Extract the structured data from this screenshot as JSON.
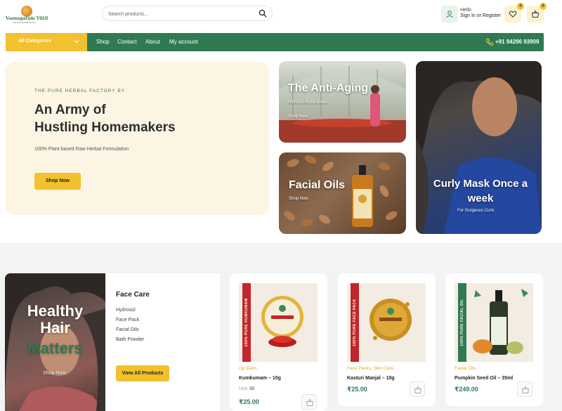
{
  "header": {
    "logo_text": "Vaanagaram Viitil",
    "logo_tagline": "The Pure Herbal Factory",
    "search_placeholder": "Search products...",
    "hello": "Hello",
    "signin": "Sign In or Register",
    "wishlist_count": "0",
    "cart_count": "0"
  },
  "nav": {
    "categories": "All Categories",
    "links": [
      "Shop",
      "Contact",
      "About",
      "My account"
    ],
    "phone": "+91 94296 93909"
  },
  "hero": {
    "eyebrow": "THE PURE HERBAL FACTORY BY",
    "title_line1": "An Army of",
    "title_line2": "Hustling Homemakers",
    "subtitle": "100% Plant based Raw Herbal Formulation",
    "cta": "Shop Now"
  },
  "tiles": {
    "anti_aging": {
      "title": "The Anti-Aging",
      "subtitle": "Hibiscus Rosa sinesis",
      "link": "Shop Now"
    },
    "facial_oils": {
      "title": "Facial Oils",
      "link": "Shop Now"
    },
    "curly": {
      "title_line1": "Curly Mask Once a",
      "title_line2": "week",
      "subtitle": "For Gorgeous Curls"
    }
  },
  "category_block": {
    "photo_line1": "Healthy",
    "photo_line2": "Hair",
    "photo_line3": "Matters",
    "photo_link": "Shop Now",
    "heading": "Face Care",
    "links": [
      "Hydrosol",
      "Face Pack",
      "Facial Oils",
      "Bath Powder"
    ],
    "cta": "View All Products"
  },
  "products": [
    {
      "category": "Lip Balm",
      "name": "Kumkumam – 10g",
      "unit_label": "Unit:",
      "unit_value": "50",
      "price": "₹25.00",
      "label_text": "100% PURE KUMKUMAM",
      "label_color": "#c2262a"
    },
    {
      "category": "Face Packs, Skin Care",
      "name": "Kasturi Manjal – 10g",
      "price": "₹25.00",
      "label_text": "100% PURE FACE PACK",
      "label_color": "#c2262a"
    },
    {
      "category": "Facial Oils",
      "name": "Pumpkin Seed Oil – 35ml",
      "price": "₹249.00",
      "label_text": "100% PURE FACIAL OIL",
      "label_color": "#2f7a52"
    }
  ],
  "colors": {
    "brand_green": "#2f7a52",
    "accent_yellow": "#f2c12e",
    "hero_bg": "#fdf5e3"
  }
}
